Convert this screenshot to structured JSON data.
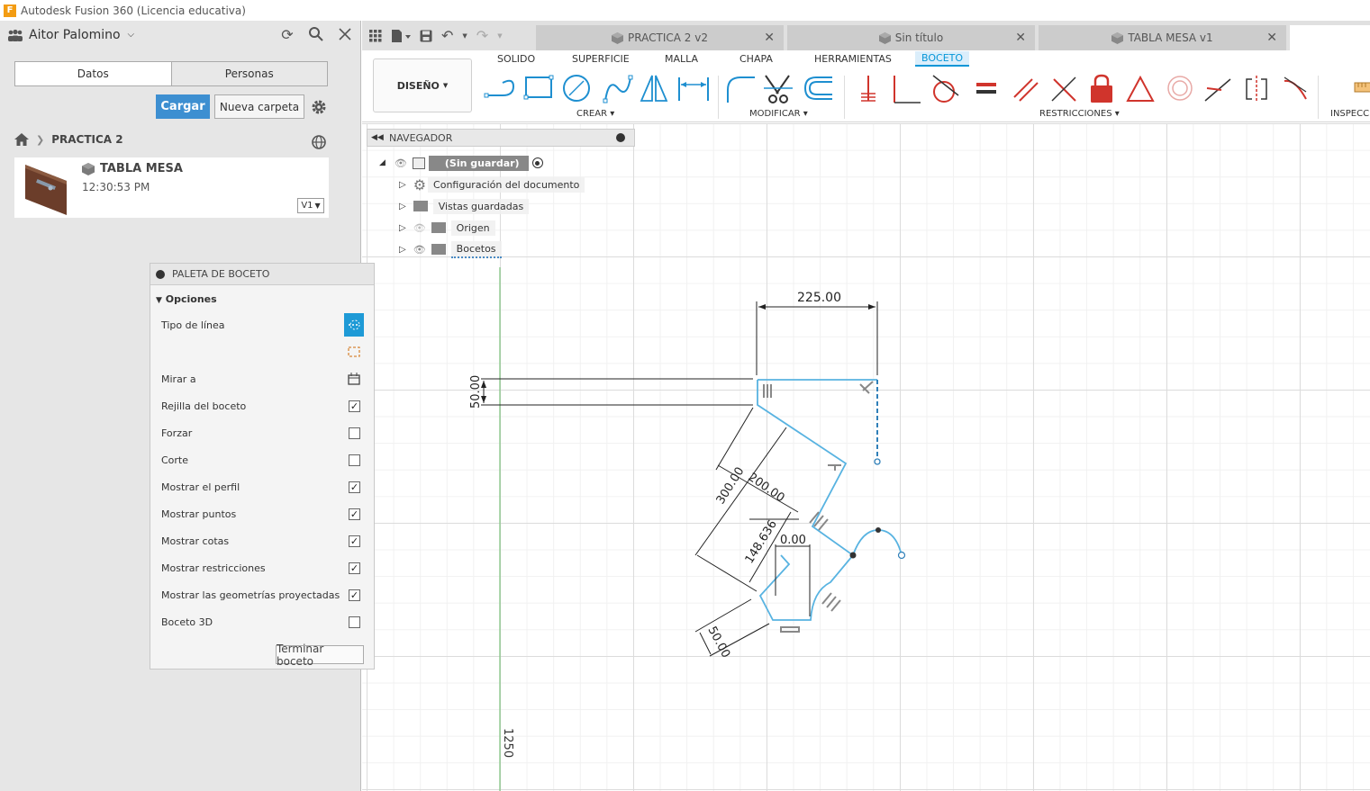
{
  "window": {
    "title": "Autodesk Fusion 360 (Licencia educativa)",
    "logo_letter": "F"
  },
  "datapanel": {
    "user": "Aitor Palomino",
    "tabs": [
      "Datos",
      "Personas"
    ],
    "upload_label": "Cargar",
    "new_folder_label": "Nueva carpeta",
    "breadcrumb": "PRACTICA 2",
    "file": {
      "name": "TABLA MESA",
      "time": "12:30:53 PM",
      "version": "V1"
    }
  },
  "doc_tabs": [
    {
      "label": "PRACTICA 2 v2"
    },
    {
      "label": "Sin título"
    },
    {
      "label": "TABLA MESA v1"
    }
  ],
  "ribbon": {
    "workspace": "DISEÑO",
    "tabs": [
      "SOLIDO",
      "SUPERFICIE",
      "MALLA",
      "CHAPA",
      "HERRAMIENTAS",
      "BOCETO"
    ],
    "active_tab": "BOCETO",
    "groups": {
      "create": "CREAR",
      "modify": "MODIFICAR",
      "constraints": "RESTRICCIONES",
      "inspect": "INSPECCI"
    }
  },
  "navigator": {
    "title": "NAVEGADOR",
    "root": "(Sin guardar)",
    "items": [
      "Configuración del documento",
      "Vistas guardadas",
      "Origen",
      "Bocetos"
    ]
  },
  "palette": {
    "title": "PALETA DE BOCETO",
    "section": "Opciones",
    "line_type": "Tipo de línea",
    "look_at": "Mirar a",
    "options": [
      {
        "label": "Rejilla del boceto",
        "checked": true
      },
      {
        "label": "Forzar",
        "checked": false
      },
      {
        "label": "Corte",
        "checked": false
      },
      {
        "label": "Mostrar el perfil",
        "checked": true
      },
      {
        "label": "Mostrar puntos",
        "checked": true
      },
      {
        "label": "Mostrar cotas",
        "checked": true
      },
      {
        "label": "Mostrar restricciones",
        "checked": true
      },
      {
        "label": "Mostrar las geometrías proyectadas",
        "checked": true
      },
      {
        "label": "Boceto 3D",
        "checked": false
      }
    ],
    "finish_label": "Terminar boceto"
  },
  "sketch": {
    "dimensions": [
      "225.00",
      "50.00",
      "300.00",
      "200.00",
      "148.636",
      "0.00",
      "50.00"
    ],
    "axis_value": "1250"
  },
  "colors": {
    "accent": "#0696d7",
    "sketch_line": "#4fb0e0",
    "constraint": "#d0342c",
    "upload_btn": "#3d8fd1"
  }
}
